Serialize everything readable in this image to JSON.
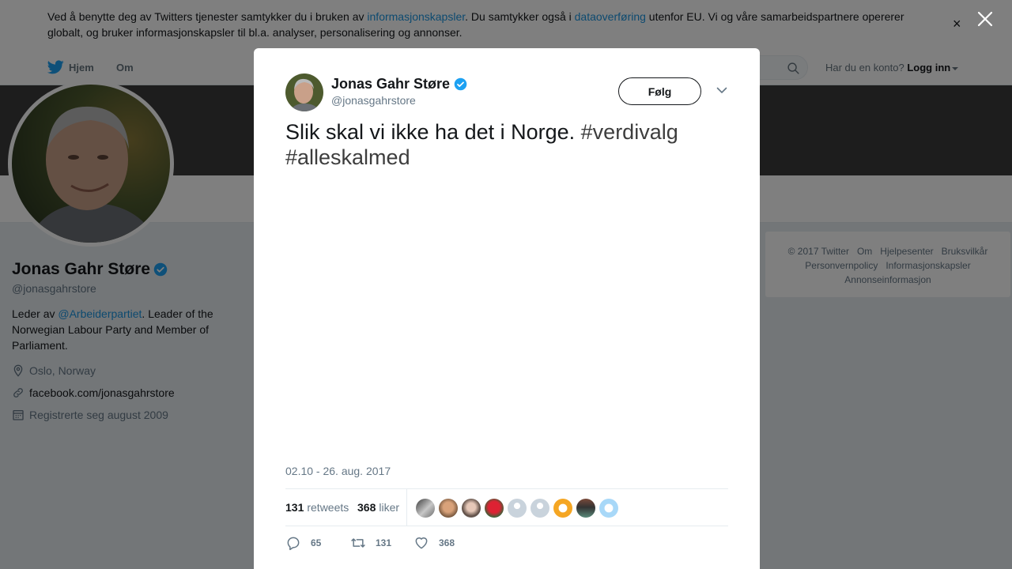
{
  "cookie_banner": {
    "text_before": "Ved å benytte deg av Twitters tjenester samtykker du i bruken av ",
    "link1": "informasjonskapsler",
    "text_mid": ". Du samtykker også i ",
    "link2": "dataoverføring",
    "text_after": " utenfor EU. Vi og våre samarbeidspartnere opererer globalt, og bruker informasjonskapsler til bl.a. analyser, personalisering og annonser.",
    "close": "×"
  },
  "nav": {
    "home": "Hjem",
    "about": "Om",
    "login_prompt": "Har du en konto?",
    "login": "Logg inn"
  },
  "profile": {
    "name": "Jonas Gahr Støre",
    "handle": "@jonasgahrstore",
    "bio_before": "Leder av ",
    "bio_link": "@Arbeiderpartiet",
    "bio_after": ". Leader of the Norwegian Labour Party and Member of Parliament.",
    "location": "Oslo, Norway",
    "website": "facebook.com/jonasgahrstore",
    "joined": "Registrerte seg august 2009"
  },
  "footer": {
    "links": [
      "© 2017 Twitter",
      "Om",
      "Hjelpesenter",
      "Bruksvilkår",
      "Personvernpolicy",
      "Informasjonskapsler",
      "Annonseinformasjon"
    ]
  },
  "tweet": {
    "name": "Jonas Gahr Støre",
    "handle": "@jonasgahrstore",
    "follow": "Følg",
    "text": "Slik skal vi ikke ha det i Norge. ",
    "tag1": "#verdivalg",
    "tag2": "#alleskalmed",
    "timestamp": "02.10 - 26. aug. 2017",
    "retweets_count": "131",
    "retweets_label": "retweets",
    "likes_count": "368",
    "likes_label": "liker",
    "reply_count": "65",
    "retweet_action_count": "131",
    "like_action_count": "368"
  },
  "colors": {
    "accent": "#1da1f2",
    "verified": "#1da1f2",
    "banner": "#3b3b3b"
  }
}
